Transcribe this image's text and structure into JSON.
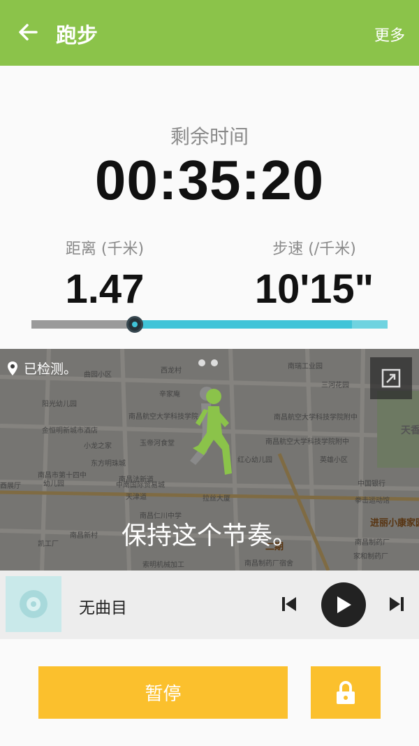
{
  "header": {
    "title": "跑步",
    "more_label": "更多",
    "back_icon": "arrow-left-icon",
    "color": "#8bc34a"
  },
  "stats": {
    "remaining_label": "剩余时间",
    "remaining_time": "00:35:20",
    "distance_label": "距离 (千米)",
    "distance_value": "1.47",
    "pace_label": "步速 (/千米)",
    "pace_value": "10'15\""
  },
  "progress": {
    "fraction": 0.29,
    "remaining_fraction": 0.9,
    "accent": "#40c4d8"
  },
  "map": {
    "detected_label": "已检测。",
    "message": "保持这个节奏。",
    "page_count": 2
  },
  "music": {
    "track": "无曲目"
  },
  "actions": {
    "pause_label": "暂停",
    "button_color": "#fbc02d"
  }
}
